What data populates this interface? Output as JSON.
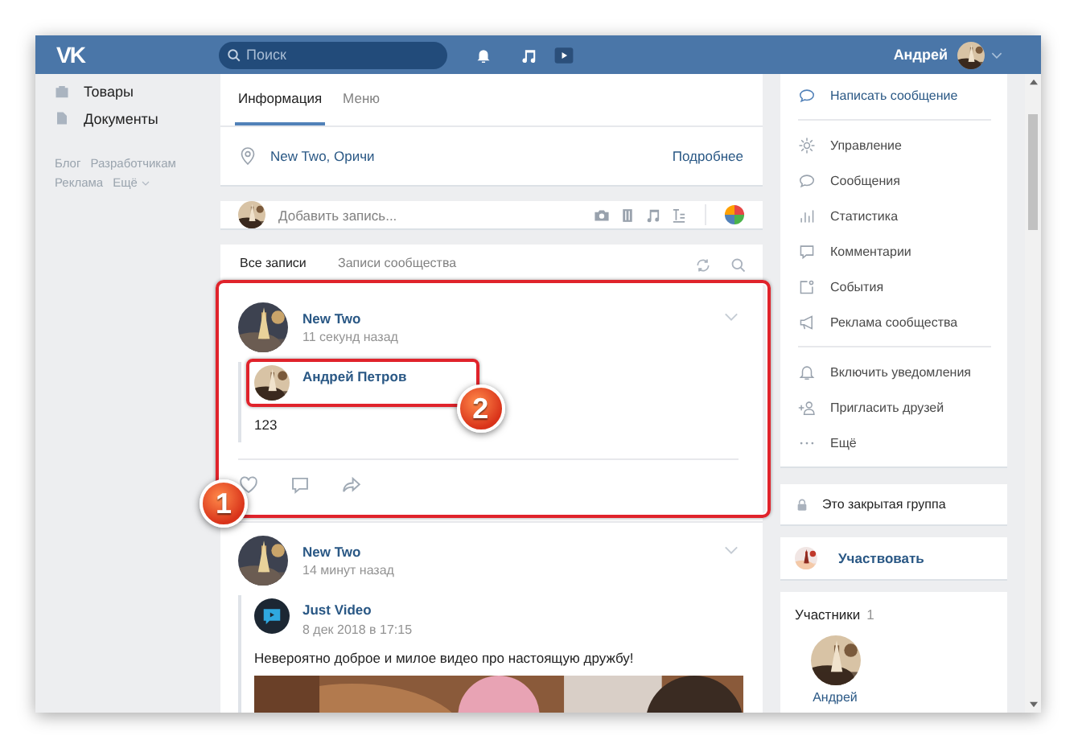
{
  "header": {
    "logo": "VK",
    "search": {
      "placeholder": "Поиск"
    },
    "user": {
      "name": "Андрей"
    }
  },
  "sidebar": {
    "items": [
      {
        "label": "Товары"
      },
      {
        "label": "Документы"
      }
    ],
    "footer_links": [
      {
        "label": "Блог",
        "dropdown": false
      },
      {
        "label": "Разработчикам",
        "dropdown": false
      },
      {
        "label": "Реклама",
        "dropdown": false
      },
      {
        "label": "Ещё",
        "dropdown": true
      }
    ]
  },
  "info": {
    "tabs": [
      {
        "label": "Информация",
        "selected": true
      },
      {
        "label": "Меню",
        "selected": false
      }
    ],
    "location": "New Two, Оричи",
    "more_link": "Подробнее"
  },
  "composer": {
    "placeholder": "Добавить запись..."
  },
  "wall": {
    "tabs": [
      {
        "label": "Все записи",
        "selected": true
      },
      {
        "label": "Записи сообщества",
        "selected": false
      }
    ],
    "posts": [
      {
        "author": "New Two",
        "time": "11 секунд назад",
        "callout": "1",
        "actions": true,
        "repost": {
          "author": "Андрей Петров",
          "callout": "2",
          "text": "123"
        }
      },
      {
        "author": "New Two",
        "time": "14 минут назад",
        "actions": false,
        "repost": {
          "author": "Just Video",
          "avatar": {
            "kind": "logo"
          },
          "date": "8 дек 2018 в 17:15",
          "text": "Невероятно доброе и милое видео про настоящую дружбу!"
        }
      }
    ]
  },
  "actions_menu": {
    "groups": [
      [
        "Написать сообщение"
      ],
      [
        "Управление",
        "Сообщения",
        "Статистика",
        "Комментарии",
        "События",
        "Реклама сообщества"
      ],
      [
        "Включить уведомления",
        "Пригласить друзей",
        "Ещё"
      ]
    ]
  },
  "closed_notice": "Это закрытая группа",
  "join": {
    "label": "Участвовать"
  },
  "members": {
    "title": "Участники",
    "count": "1",
    "people": [
      {
        "name": "Андрей"
      }
    ]
  }
}
